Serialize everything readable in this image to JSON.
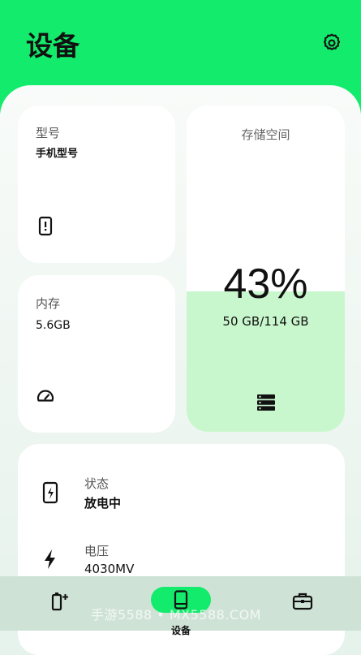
{
  "header": {
    "title": "设备",
    "settings_icon": "gear-icon",
    "color": "#12eb6b"
  },
  "cards": {
    "model": {
      "label": "型号",
      "value": "手机型号",
      "icon": "phone-info-icon"
    },
    "memory": {
      "label": "内存",
      "value": "5.6GB",
      "icon": "speedometer-icon"
    },
    "storage": {
      "label": "存储空间",
      "percent_text": "43%",
      "detail": "50 GB/114 GB",
      "used_fraction": 0.43,
      "fill_color": "#c9f7cd",
      "icon": "storage-list-icon"
    }
  },
  "battery_info": [
    {
      "label": "状态",
      "value": "放电中",
      "icon": "battery-charging-icon"
    },
    {
      "label": "电压",
      "value": "4030MV",
      "icon": "lightning-icon"
    }
  ],
  "nav": {
    "items": [
      {
        "name": "battery",
        "icon": "battery-plus-icon"
      },
      {
        "name": "device",
        "icon": "phone-icon",
        "label": "设备",
        "active": true
      },
      {
        "name": "toolbox",
        "icon": "toolbox-icon"
      }
    ]
  },
  "watermark": "手游5588 • MX5588.COM"
}
